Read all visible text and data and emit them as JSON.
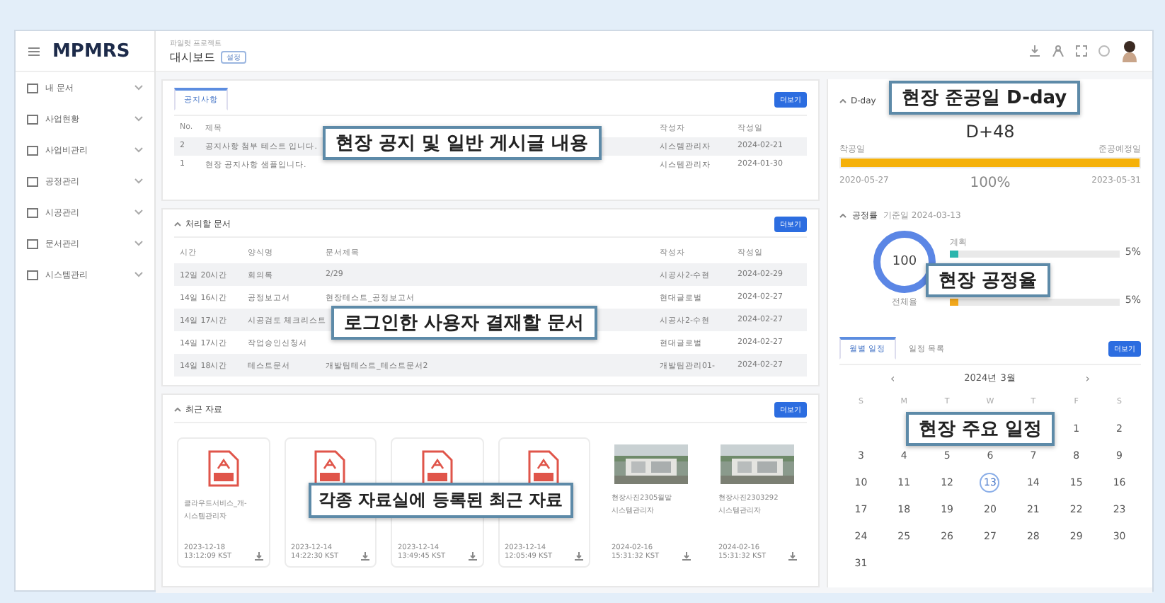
{
  "logo": "MPMRS",
  "sidebar": {
    "items": [
      {
        "label": "내 문서"
      },
      {
        "label": "사업현황"
      },
      {
        "label": "사업비관리"
      },
      {
        "label": "공정관리"
      },
      {
        "label": "시공관리"
      },
      {
        "label": "문서관리"
      },
      {
        "label": "시스템관리"
      }
    ]
  },
  "header": {
    "breadcrumb": "파일럿 프로젝트",
    "title": "대시보드",
    "badge": "설정"
  },
  "notices": {
    "tabs": [
      {
        "label": "공지사항",
        "selected": true
      }
    ],
    "more": "더보기",
    "columns": [
      "No.",
      "제목",
      "작성자",
      "작성일"
    ],
    "rows": [
      {
        "cells": [
          "2",
          "공지사항 첨부 테스트 입니다.",
          "시스템관리자",
          "2024-02-21"
        ]
      },
      {
        "cells": [
          "1",
          "현장 공지사항 샘플입니다.",
          "시스템관리자",
          "2024-01-30"
        ]
      }
    ]
  },
  "pending": {
    "title": "처리할 문서",
    "more": "더보기",
    "columns": [
      "시간",
      "양식명",
      "문서제목",
      "작성자",
      "작성일"
    ],
    "rows": [
      {
        "time": "12일 20시간",
        "form": "회의록",
        "title": "2/29",
        "author": "시공사2-수현",
        "date": "2024-02-29"
      },
      {
        "time": "14일 16시간",
        "form": "공정보고서",
        "title": "현장테스트_공정보고서",
        "author": "현대글로벌",
        "date": "2024-02-27"
      },
      {
        "time": "14일 17시간",
        "form": "시공검토 체크리스트",
        "author": "시공사2-수현",
        "date": "2024-02-27"
      },
      {
        "time": "14일 17시간",
        "form": "작업승인신청서",
        "author": "현대글로벌",
        "date": "2024-02-27"
      },
      {
        "time": "14일 18시간",
        "form": "테스트문서",
        "title": "개발팀테스트_테스트문서2",
        "author": "개발팀관리01-",
        "date": "2024-02-27"
      }
    ]
  },
  "recent": {
    "title": "최근 자료",
    "more": "더보기",
    "files": [
      {
        "kind": "pdf",
        "name": "클라우드서비스_개-",
        "owner": "시스템관리자",
        "date": "2023-12-18",
        "time": "13:12:09 KST"
      },
      {
        "kind": "pdf",
        "date": "2023-12-14",
        "time": "14:22:30 KST"
      },
      {
        "kind": "pdf",
        "date": "2023-12-14",
        "time": "13:49:45 KST"
      },
      {
        "kind": "pdf",
        "date": "2023-12-14",
        "time": "12:05:49 KST"
      },
      {
        "name": "현장사진2305월말",
        "owner": "시스템관리자",
        "date": "2024-02-16",
        "time": "15:31:32 KST"
      },
      {
        "name": "현장사진2303292",
        "owner": "시스템관리자",
        "date": "2024-02-16",
        "time": "15:31:32 KST"
      }
    ]
  },
  "dday": {
    "title": "D-day",
    "value": "D+48",
    "start_label": "착공일",
    "end_label": "준공예정일",
    "level": 1,
    "start": "2020-05-27",
    "percent": "100%",
    "end": "2023-05-31"
  },
  "progress": {
    "title": "공정률",
    "date": "기준일 2024-03-13",
    "donut_value": "100",
    "donut_label": "전체율",
    "bars": [
      {
        "label": "계획",
        "value": "5%",
        "color": "#2bb5ad",
        "level": 0.05
      },
      {
        "value": "5%",
        "color": "#f2a81d",
        "level": 0.05
      }
    ]
  },
  "calendar": {
    "tabs": [
      {
        "label": "월별 일정",
        "selected": true
      },
      {
        "label": "일정 목록",
        "selected": false
      }
    ],
    "more": "더보기",
    "prev": "‹",
    "month": "2024년 3월",
    "next": "›",
    "weekdays": [
      "S",
      "M",
      "T",
      "W",
      "T",
      "F",
      "S"
    ],
    "weeks": [
      [
        {
          "d": "1",
          "today": false
        },
        {
          "d": "2",
          "today": false
        }
      ],
      [
        {
          "d": "3",
          "today": false
        },
        {
          "d": "4",
          "today": false
        },
        {
          "d": "5",
          "today": false
        },
        {
          "d": "6",
          "today": false
        },
        {
          "d": "7",
          "today": false
        },
        {
          "d": "8",
          "today": false
        },
        {
          "d": "9",
          "today": false
        }
      ],
      [
        {
          "d": "10",
          "today": false
        },
        {
          "d": "11",
          "today": false
        },
        {
          "d": "12",
          "today": false
        },
        {
          "d": "13",
          "today": true
        },
        {
          "d": "14",
          "today": false
        },
        {
          "d": "15",
          "today": false
        },
        {
          "d": "16",
          "today": false
        }
      ],
      [
        {
          "d": "17",
          "today": false
        },
        {
          "d": "18",
          "today": false
        },
        {
          "d": "19",
          "today": false
        },
        {
          "d": "20",
          "today": false
        },
        {
          "d": "21",
          "today": false
        },
        {
          "d": "22",
          "today": false
        },
        {
          "d": "23",
          "today": false
        }
      ],
      [
        {
          "d": "24",
          "today": false
        },
        {
          "d": "25",
          "today": false
        },
        {
          "d": "26",
          "today": false
        },
        {
          "d": "27",
          "today": false
        },
        {
          "d": "28",
          "today": false
        },
        {
          "d": "29",
          "today": false
        },
        {
          "d": "30",
          "today": false
        }
      ],
      [
        {
          "d": "31",
          "today": false
        }
      ]
    ]
  },
  "callouts": [
    {
      "text": "현장 공지 및 일반 게시글 내용"
    },
    {
      "text": "현장 준공일 D-day"
    },
    {
      "text": "로그인한 사용자 결재할 문서"
    },
    {
      "text": "현장 공정율"
    },
    {
      "text": "현장 주요 일정"
    },
    {
      "text": "각종 자료실에 등록된 최근 자료"
    }
  ]
}
